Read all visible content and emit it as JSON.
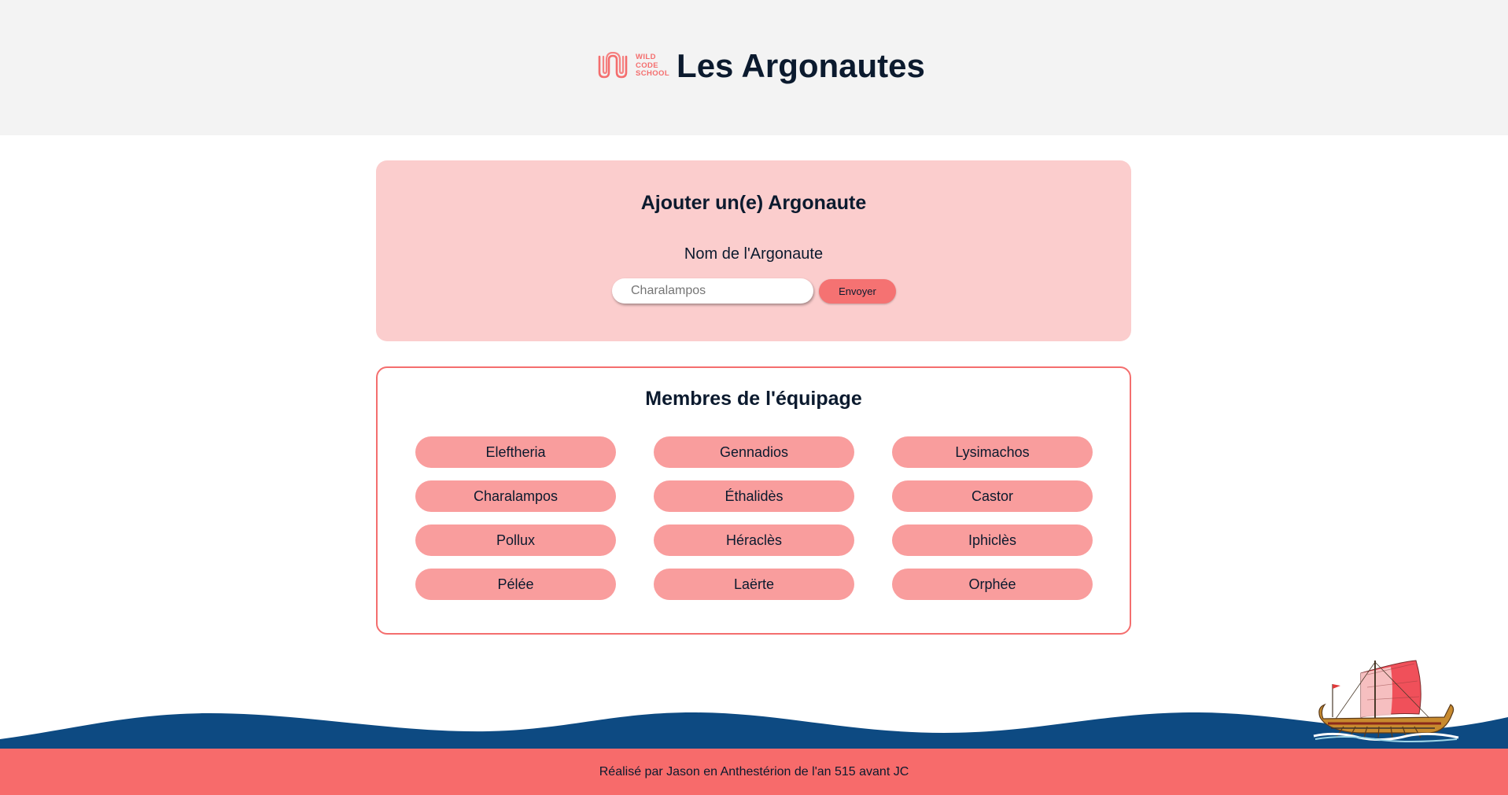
{
  "header": {
    "logo_text": [
      "WILD",
      "CODE",
      "SCHOOL"
    ],
    "title": "Les Argonautes"
  },
  "form": {
    "title": "Ajouter un(e) Argonaute",
    "label": "Nom de l'Argonaute",
    "input_placeholder": "Charalampos",
    "input_value": "",
    "submit_label": "Envoyer"
  },
  "crew": {
    "title": "Membres de l'équipage",
    "members": [
      "Eleftheria",
      "Gennadios",
      "Lysimachos",
      "Charalampos",
      "Éthalidès",
      "Castor",
      "Pollux",
      "Héraclès",
      "Iphiclès",
      "Pélée",
      "Laërte",
      "Orphée"
    ]
  },
  "footer": {
    "text": "Réalisé par Jason en Anthestérion de l'an 515 avant JC"
  },
  "colors": {
    "header_bg": "#f3f3f3",
    "form_bg": "#fbcdcd",
    "accent": "#f46e6e",
    "chip_bg": "#f99d9d",
    "sea": "#0d4a82",
    "footer_bg": "#f76b6b",
    "text": "#0b1a2e"
  },
  "icons": {
    "logo": "wild-code-school-logo",
    "ship": "greek-ship-illustration"
  }
}
